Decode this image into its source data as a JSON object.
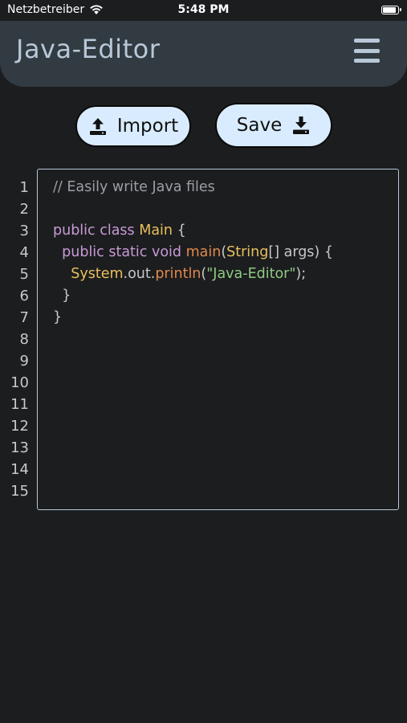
{
  "status": {
    "carrier": "Netzbetreiber",
    "time": "5:48 PM",
    "battery_fraction": 0.95
  },
  "header": {
    "title": "Java-Editor",
    "menu_icon": "hamburger-menu-icon"
  },
  "toolbar": {
    "import_label": "Import",
    "import_icon": "upload-icon",
    "save_label": "Save",
    "save_icon": "download-icon"
  },
  "editor": {
    "line_numbers": [
      "1",
      "2",
      "3",
      "4",
      "5",
      "6",
      "7",
      "8",
      "9",
      "10",
      "11",
      "12",
      "13",
      "14",
      "15"
    ],
    "lines": [
      [
        {
          "t": "comment",
          "v": "// Easily write Java files"
        }
      ],
      [],
      [
        {
          "t": "keyword",
          "v": "public class "
        },
        {
          "t": "type",
          "v": "Main"
        },
        {
          "t": "plain",
          "v": " {"
        }
      ],
      [
        {
          "t": "plain",
          "v": "  "
        },
        {
          "t": "keyword",
          "v": "public static void "
        },
        {
          "t": "method",
          "v": "main"
        },
        {
          "t": "plain",
          "v": "("
        },
        {
          "t": "type",
          "v": "String"
        },
        {
          "t": "plain",
          "v": "[] args) {"
        }
      ],
      [
        {
          "t": "plain",
          "v": "    "
        },
        {
          "t": "type",
          "v": "System"
        },
        {
          "t": "plain",
          "v": ".out."
        },
        {
          "t": "method",
          "v": "println"
        },
        {
          "t": "plain",
          "v": "("
        },
        {
          "t": "string",
          "v": "\"Java-Editor\""
        },
        {
          "t": "plain",
          "v": ");"
        }
      ],
      [
        {
          "t": "plain",
          "v": "  }"
        }
      ],
      [
        {
          "t": "plain",
          "v": "}"
        }
      ]
    ]
  },
  "colors": {
    "background": "#1c1d1f",
    "header": "#323a42",
    "accent": "#b8c8d8",
    "button_fill": "#d9ecff"
  }
}
